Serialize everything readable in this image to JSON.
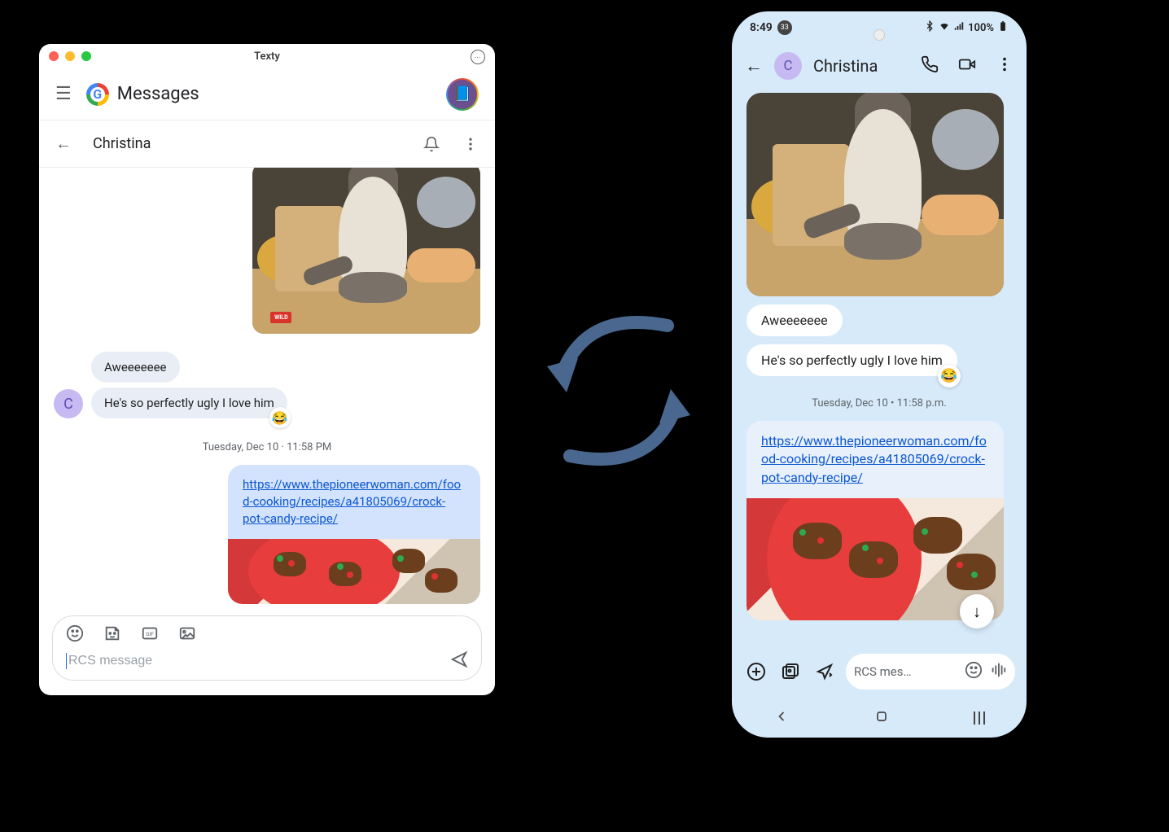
{
  "desktop": {
    "window_title": "Texty",
    "app_title": "Messages",
    "conversation": {
      "contact_name": "Christina",
      "contact_initial": "C",
      "messages": {
        "incoming_1": "Aweeeeeee",
        "incoming_2": "He's so perfectly ugly I love him",
        "reaction_emoji": "😂",
        "image_tag": "WILD"
      },
      "timestamp": "Tuesday, Dec 10 · 11:58 PM",
      "outgoing_link": "https://www.thepioneerwoman.com/food-cooking/recipes/a41805069/crock-pot-candy-recipe/"
    },
    "composer_placeholder": "RCS message"
  },
  "phone": {
    "status": {
      "time": "8:49",
      "notif_count": "33",
      "battery_text": "100%"
    },
    "header": {
      "contact_name": "Christina",
      "contact_initial": "C"
    },
    "messages": {
      "incoming_1": "Aweeeeeee",
      "incoming_2": "He's so perfectly ugly I love him",
      "reaction_emoji": "😂"
    },
    "timestamp": "Tuesday, Dec 10 • 11:58 p.m.",
    "outgoing_link": "https://www.thepioneerwoman.com/food-cooking/recipes/a41805069/crock-pot-candy-recipe/",
    "composer_placeholder": "RCS mes…"
  }
}
